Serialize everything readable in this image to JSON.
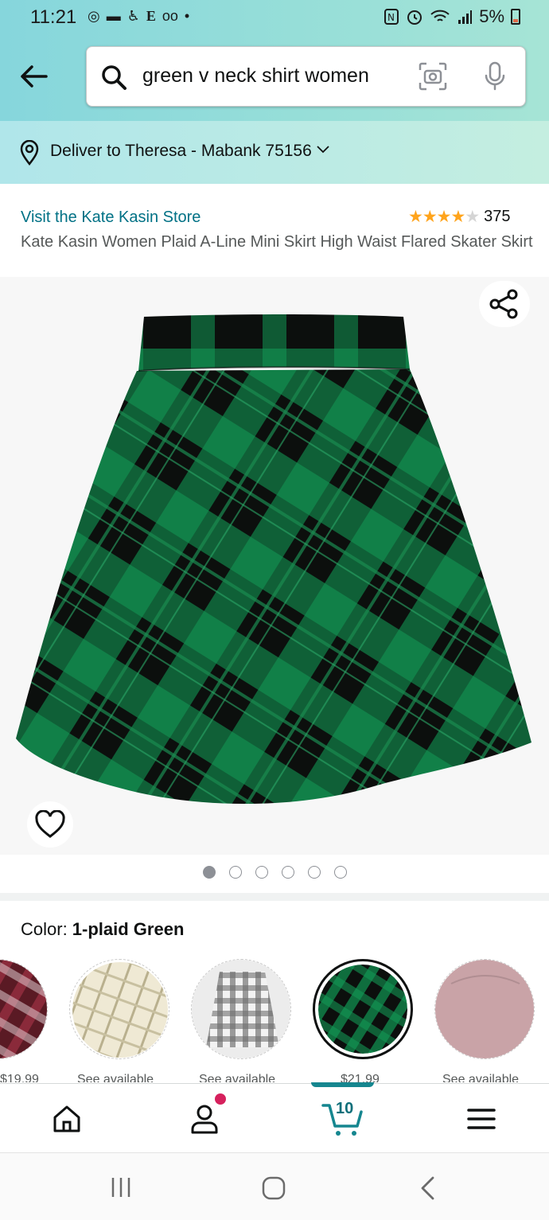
{
  "status_bar": {
    "time": "11:21",
    "left_icons": [
      "sync-icon",
      "chat-icon",
      "accessibility-icon",
      "e-icon",
      "voicemail-icon",
      "dot-icon"
    ],
    "left_glyphs": [
      "◎",
      "▬",
      "♿",
      "E",
      "oo",
      "•"
    ],
    "battery_percent": "5%"
  },
  "search": {
    "query": "green v neck shirt women"
  },
  "delivery": {
    "text": "Deliver to Theresa - Mabank 75156"
  },
  "product": {
    "store_link": "Visit the Kate Kasin Store",
    "rating": 4.0,
    "rating_count": "375",
    "title": "Kate Kasin Women Plaid A-Line Mini Skirt High Waist Flared Skater Skirt",
    "image_count": 6,
    "active_image": 0
  },
  "color": {
    "label": "Color: ",
    "selected": "1-plaid Green",
    "swatches": [
      {
        "name": "red-plaid",
        "price": "$19.99",
        "base": "#6a1f2c"
      },
      {
        "name": "beige-plaid",
        "price": "See available",
        "base": "#ece6cf"
      },
      {
        "name": "grey-plaid",
        "price": "See available",
        "base": "#d4d4d4"
      },
      {
        "name": "green-plaid",
        "price": "$21.99",
        "base": "#0b3a22"
      },
      {
        "name": "pink",
        "price": "See available",
        "base": "#c9a3a7"
      }
    ]
  },
  "nav": {
    "cart_count": "10"
  },
  "colors": {
    "link": "#007185",
    "star": "#ffa41c",
    "header_teal": "#8fdad9",
    "cart_accent": "#15868f"
  }
}
